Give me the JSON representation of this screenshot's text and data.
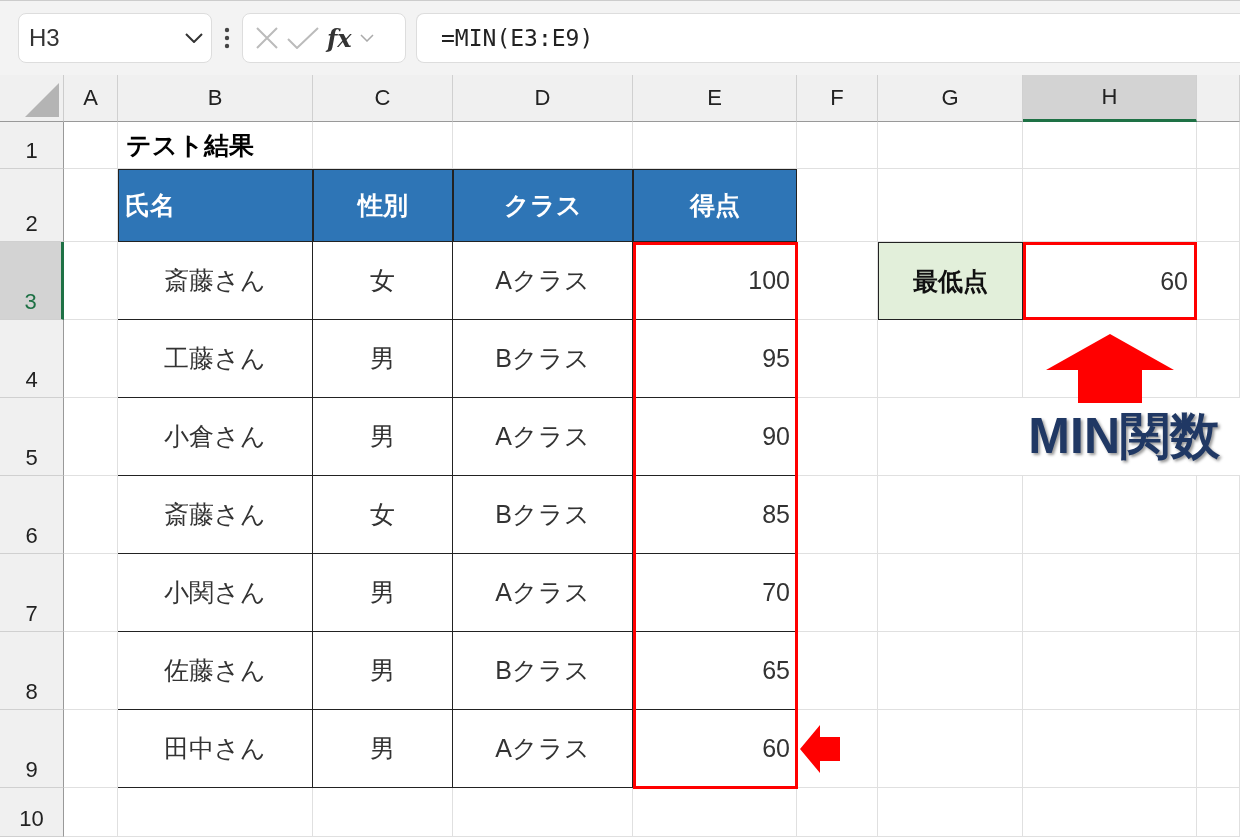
{
  "formula_bar": {
    "name_box": "H3",
    "fx": "fx",
    "formula": "=MIN(E3:E9)"
  },
  "columns": [
    {
      "label": "A",
      "selected": false
    },
    {
      "label": "B",
      "selected": false
    },
    {
      "label": "C",
      "selected": false
    },
    {
      "label": "D",
      "selected": false
    },
    {
      "label": "E",
      "selected": false
    },
    {
      "label": "F",
      "selected": false
    },
    {
      "label": "G",
      "selected": false
    },
    {
      "label": "H",
      "selected": true
    }
  ],
  "rows": [
    {
      "label": "1",
      "selected": false
    },
    {
      "label": "2",
      "selected": false
    },
    {
      "label": "3",
      "selected": true
    },
    {
      "label": "4",
      "selected": false
    },
    {
      "label": "5",
      "selected": false
    },
    {
      "label": "6",
      "selected": false
    },
    {
      "label": "7",
      "selected": false
    },
    {
      "label": "8",
      "selected": false
    },
    {
      "label": "9",
      "selected": false
    },
    {
      "label": "10",
      "selected": false
    }
  ],
  "sheet": {
    "title": "テスト結果",
    "table": {
      "columns": [
        "氏名",
        "性別",
        "クラス",
        "得点"
      ],
      "rows": [
        [
          "斎藤さん",
          "女",
          "Aクラス",
          "100"
        ],
        [
          "工藤さん",
          "男",
          "Bクラス",
          "95"
        ],
        [
          "小倉さん",
          "男",
          "Aクラス",
          "90"
        ],
        [
          "斎藤さん",
          "女",
          "Bクラス",
          "85"
        ],
        [
          "小関さん",
          "男",
          "Aクラス",
          "70"
        ],
        [
          "佐藤さん",
          "男",
          "Bクラス",
          "65"
        ],
        [
          "田中さん",
          "男",
          "Aクラス",
          "60"
        ]
      ]
    },
    "summary": {
      "label": "最低点",
      "value": "60",
      "selected": true
    }
  },
  "annotation": {
    "label": "MIN関数"
  }
}
